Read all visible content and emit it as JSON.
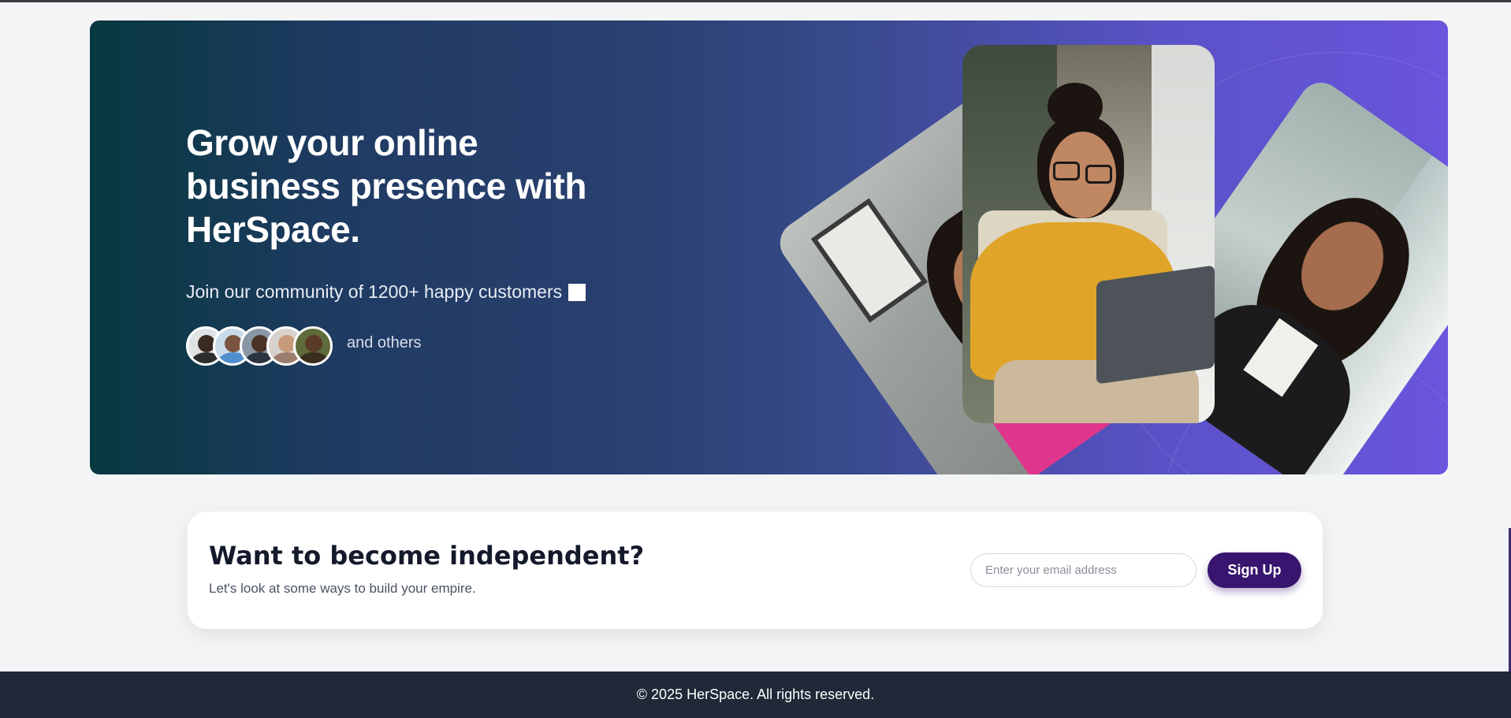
{
  "hero": {
    "title_line1": "Grow your online",
    "title_line2": "business presence with",
    "title_line3": "HerSpace.",
    "subtitle_prefix": "Join our community of ",
    "subtitle_count": "1200+ happy customers",
    "and_others": "and others"
  },
  "cta": {
    "title": "Want to become independent?",
    "subtitle": "Let's look at some ways to build your empire.",
    "email_placeholder": "Enter your email address",
    "signup_label": "Sign Up"
  },
  "footer": {
    "copyright": "© 2025 HerSpace. All rights reserved."
  },
  "colors": {
    "hero_gradient_start": "#07383f",
    "hero_gradient_end": "#6a55dc",
    "signup_button": "#38156e",
    "footer_bg": "#1f2937"
  }
}
